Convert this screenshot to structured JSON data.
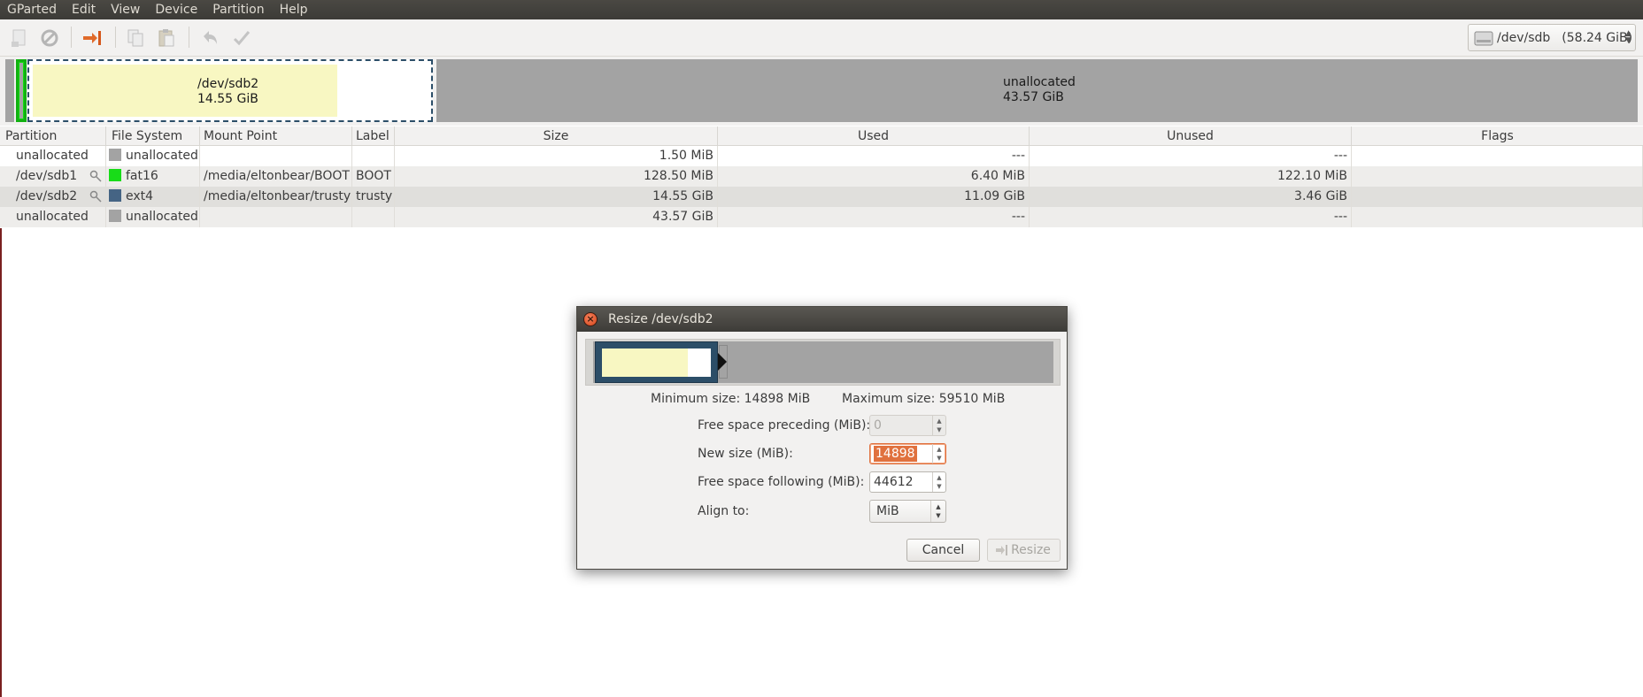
{
  "menubar": {
    "items": [
      "GParted",
      "Edit",
      "View",
      "Device",
      "Partition",
      "Help"
    ]
  },
  "toolbar": {
    "buttons": [
      "new-icon",
      "delete-icon",
      "resize-move-icon",
      "copy-icon",
      "paste-icon",
      "undo-icon",
      "apply-icon"
    ],
    "device": "/dev/sdb",
    "device_size": "(58.24 GiB)"
  },
  "diskmap": {
    "sdb2": {
      "name": "/dev/sdb2",
      "size": "14.55 GiB"
    },
    "unallocated": {
      "name": "unallocated",
      "size": "43.57 GiB"
    }
  },
  "table": {
    "headers": [
      "Partition",
      "File System",
      "Mount Point",
      "Label",
      "Size",
      "Used",
      "Unused",
      "Flags"
    ],
    "rows": [
      {
        "partition": "unallocated",
        "fs": "unallocated",
        "fs_color": "#a3a3a3",
        "mount": "",
        "label": "",
        "size": "1.50 MiB",
        "used": "---",
        "unused": "---",
        "flags": ""
      },
      {
        "partition": "/dev/sdb1",
        "fs": "fat16",
        "fs_color": "#18dc18",
        "mount": "/media/eltonbear/BOOT",
        "label": "BOOT",
        "size": "128.50 MiB",
        "used": "6.40 MiB",
        "unused": "122.10 MiB",
        "flags": ""
      },
      {
        "partition": "/dev/sdb2",
        "fs": "ext4",
        "fs_color": "#456484",
        "mount": "/media/eltonbear/trusty",
        "label": "trusty",
        "size": "14.55 GiB",
        "used": "11.09 GiB",
        "unused": "3.46 GiB",
        "flags": ""
      },
      {
        "partition": "unallocated",
        "fs": "unallocated",
        "fs_color": "#a3a3a3",
        "mount": "",
        "label": "",
        "size": "43.57 GiB",
        "used": "---",
        "unused": "---",
        "flags": ""
      }
    ]
  },
  "dialog": {
    "title": "Resize /dev/sdb2",
    "min_size": "Minimum size: 14898 MiB",
    "max_size": "Maximum size: 59510 MiB",
    "free_preceding_label": "Free space preceding (MiB):",
    "free_preceding_value": "0",
    "new_size_label": "New size (MiB):",
    "new_size_value": "14898",
    "free_following_label": "Free space following (MiB):",
    "free_following_value": "44612",
    "align_label": "Align to:",
    "align_value": "MiB",
    "cancel_label": "Cancel",
    "resize_label": "Resize"
  }
}
